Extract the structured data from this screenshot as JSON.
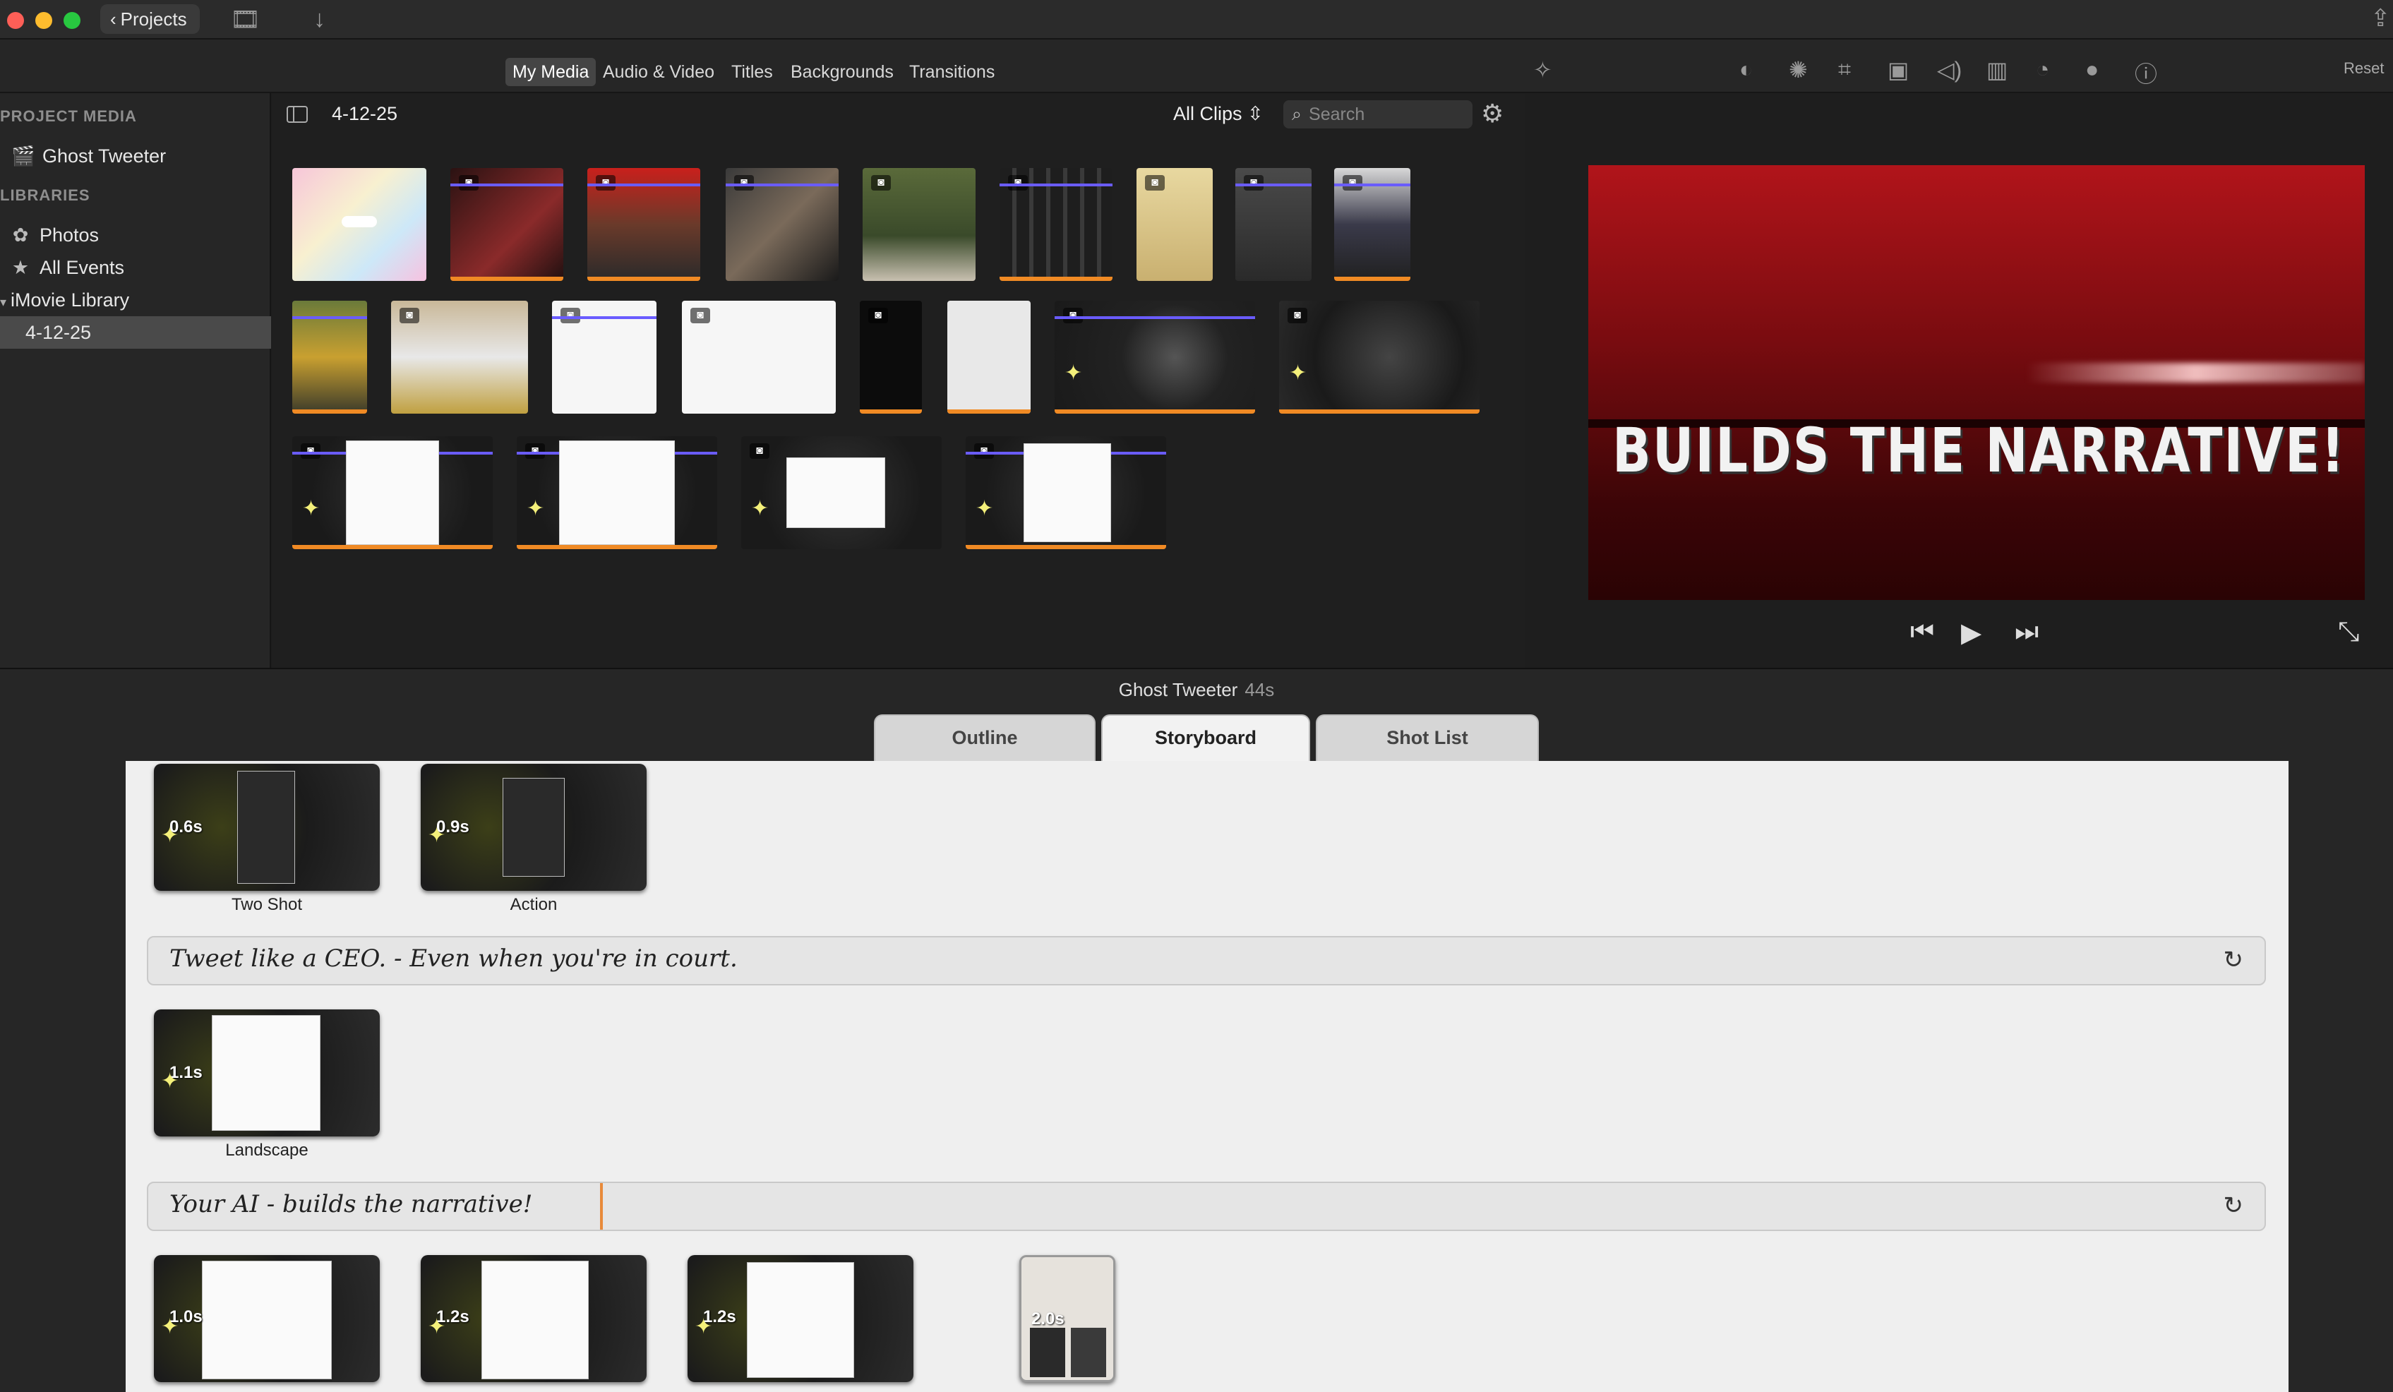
{
  "window": {
    "projects_label": "Projects",
    "chevron_glyph": "‹",
    "filmstrip_glyph": "🎞",
    "download_glyph": "↓",
    "share_glyph": "⇪"
  },
  "media_tabs": [
    "My Media",
    "Audio & Video",
    "Titles",
    "Backgrounds",
    "Transitions"
  ],
  "sidebar": {
    "project_media_heading": "PROJECT MEDIA",
    "project_item": "Ghost Tweeter",
    "libraries_heading": "LIBRARIES",
    "photos": "Photos",
    "all_events": "All Events",
    "library": "iMovie Library",
    "event": "4-12-25"
  },
  "browser": {
    "event_title": "4-12-25",
    "filter": "All Clips",
    "search_placeholder": "Search"
  },
  "viewer": {
    "reset_label": "Reset",
    "caption": "BUILDS THE NARRATIVE!"
  },
  "project": {
    "title": "Ghost Tweeter",
    "duration": "44s",
    "tabs": [
      "Outline",
      "Storyboard",
      "Shot List"
    ],
    "active_tab": "Storyboard"
  },
  "storyboard": {
    "group1": [
      {
        "duration": "0.6s",
        "label": "Two Shot"
      },
      {
        "duration": "0.9s",
        "label": "Action"
      }
    ],
    "note1": "Tweet like a CEO.  - Even when you're in court.",
    "group2": [
      {
        "duration": "1.1s",
        "label": "Landscape"
      }
    ],
    "note2": "Your AI  - builds the narrative!",
    "group3": [
      {
        "duration": "1.0s"
      },
      {
        "duration": "1.2s"
      },
      {
        "duration": "1.2s"
      },
      {
        "duration": "2.0s"
      }
    ]
  },
  "colors": {
    "accent_orange": "#f08a24",
    "used_bar_purple": "#6a5cff",
    "viewer_red": "#b1141a"
  }
}
